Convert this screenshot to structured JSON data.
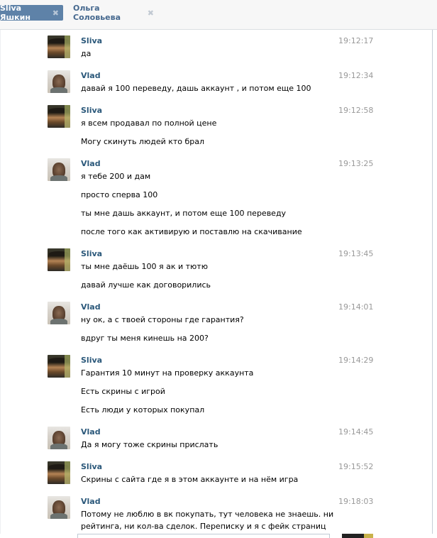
{
  "tabs": [
    {
      "label": "Sliva Яшкин",
      "active": true
    },
    {
      "label": "Ольга Соловьева",
      "active": false
    }
  ],
  "messages": [
    {
      "author": "Sliva",
      "time": "19:12:17",
      "avatar": "sliva",
      "lines": [
        "да"
      ]
    },
    {
      "author": "Vlad",
      "time": "19:12:34",
      "avatar": "vlad",
      "lines": [
        "давай я 100 переведу, дашь аккаунт , и потом еще 100"
      ]
    },
    {
      "author": "Sliva",
      "time": "19:12:58",
      "avatar": "sliva",
      "lines": [
        "я всем продавал по полной цене",
        "Могу скинуть людей кто брал"
      ]
    },
    {
      "author": "Vlad",
      "time": "19:13:25",
      "avatar": "vlad",
      "lines": [
        "я тебе 200 и дам",
        "просто сперва 100",
        "ты мне дашь аккаунт, и потом еще 100 переведу",
        "после того как активирую и поставлю на скачивание"
      ]
    },
    {
      "author": "Sliva",
      "time": "19:13:45",
      "avatar": "sliva",
      "lines": [
        "ты мне даёшь 100 я ак и тютю",
        "давай лучше как договорились"
      ]
    },
    {
      "author": "Vlad",
      "time": "19:14:01",
      "avatar": "vlad",
      "lines": [
        "ну ок, а с твоей стороны где гарантия?",
        "вдруг ты меня кинешь на 200?"
      ]
    },
    {
      "author": "Sliva",
      "time": "19:14:29",
      "avatar": "sliva",
      "lines": [
        "Гарантия 10 минут на проверку аккаунта",
        "Есть скрины с игрой",
        "Есть люди у которых покупал"
      ]
    },
    {
      "author": "Vlad",
      "time": "19:14:45",
      "avatar": "vlad",
      "lines": [
        "Да я могу тоже скрины прислать"
      ]
    },
    {
      "author": "Sliva",
      "time": "19:15:52",
      "avatar": "sliva",
      "lines": [
        "Скрины с сайта где я в этом аккаунте и на нём игра"
      ]
    },
    {
      "author": "Vlad",
      "time": "19:18:03",
      "avatar": "vlad",
      "lines": [
        "Потому не люблю в вк покупать, тут человека не знаешь. ни",
        "рейтинга, ни кол-ва сделок. Переписку и я с фейк страниц"
      ]
    }
  ],
  "colors": {
    "author": "#2b587a",
    "time": "#999999",
    "active_tab": "#5e82a8"
  },
  "icons": {
    "tab_close": "close-icon"
  }
}
